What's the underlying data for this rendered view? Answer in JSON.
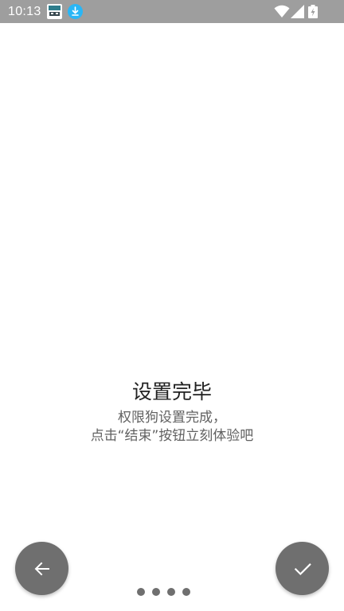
{
  "status_bar": {
    "time": "10:13",
    "background": "#9e9e9e",
    "notification_icons": [
      "app-notification-icon",
      "download-icon"
    ],
    "system_icons": [
      "wifi-icon",
      "cellular-signal-icon",
      "battery-charging-icon"
    ]
  },
  "main": {
    "title": "设置完毕",
    "description_lines": [
      "权限狗设置完成，",
      "点击“结束”按钮立刻体验吧"
    ]
  },
  "navigation": {
    "back_icon": "arrow-left-icon",
    "done_icon": "checkmark-icon",
    "button_color": "#6f6f6f",
    "page_count": 4
  }
}
